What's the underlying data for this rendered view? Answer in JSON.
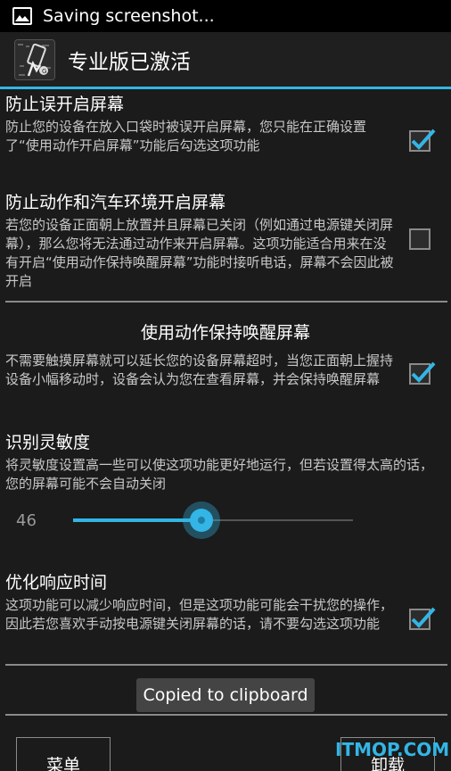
{
  "status_bar": {
    "icon": "image-icon",
    "text": "Saving screenshot..."
  },
  "action_bar": {
    "app_icon": "app-icon",
    "title": "专业版已激活"
  },
  "prefs": [
    {
      "title": "防止误开启屏幕",
      "summary": "防止您的设备在放入口袋时被误开启屏幕，您只能在正确设置了“使用动作开启屏幕”功能后勾选这项功能",
      "checked": true
    },
    {
      "title": "防止动作和汽车环境开启屏幕",
      "summary": "若您的设备正面朝上放置并且屏幕已关闭（例如通过电源键关闭屏幕），那么您将无法通过动作来开启屏幕。这项功能适合用来在没有开启“使用动作保持唤醒屏幕”功能时接听电话，屏幕不会因此被开启",
      "checked": false
    }
  ],
  "section_header": "使用动作保持唤醒屏幕",
  "keep_awake": {
    "summary": "不需要触摸屏幕就可以延长您的设备屏幕超时，当您正面朝上握持设备小幅移动时，设备会认为您在查看屏幕，并会保持唤醒屏幕",
    "checked": true
  },
  "sensitivity": {
    "title": "识别灵敏度",
    "summary": "将灵敏度设置高一些可以使这项功能更好地运行，但若设置得太高的话，您的屏幕可能不会自动关闭",
    "value": "46",
    "fraction": 0.46
  },
  "response": {
    "title": "优化响应时间",
    "summary": "这项功能可以减少响应时间，但是这项功能可能会干扰您的操作，因此若您喜欢手动按电源键关闭屏幕的话，请不要勾选这项功能",
    "checked": true
  },
  "toast": "Copied to clipboard",
  "buttons": {
    "menu": "菜单",
    "uninstall": "卸载"
  },
  "watermark": "ITMOP.COM",
  "colors": {
    "accent": "#33b5e5"
  }
}
